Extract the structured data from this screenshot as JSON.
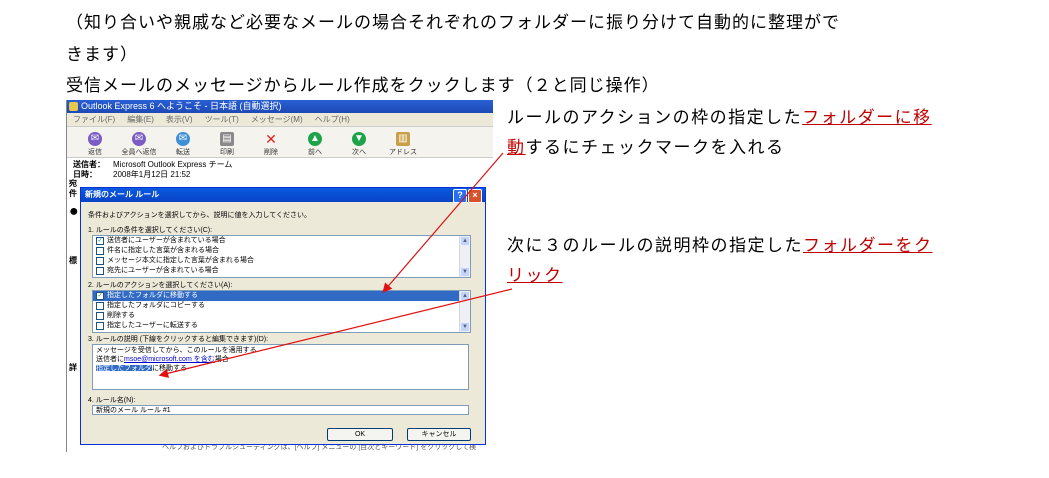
{
  "doc": {
    "line1": "（知り合いや親戚など必要なメールの場合それぞれのフォルダーに振り分けて自動的に整理がで",
    "line2": "きます）",
    "line3": "受信メールのメッセージからルール作成をクックします（２と同じ操作）"
  },
  "note1": {
    "text_a": "ルールのアクションの枠の指定した",
    "link_a": "フォルダーに移",
    "link_b": "動",
    "text_b": "するにチェックマークを入れる"
  },
  "note2": {
    "text_a": "次に３のルールの説明枠の指定した",
    "link_a": "フォルダーをク",
    "link_b": "リック"
  },
  "outlook": {
    "title": "Outlook Express 6 へようこそ - 日本語 (自動選択)",
    "menu": [
      "ファイル(F)",
      "編集(E)",
      "表示(V)",
      "ツール(T)",
      "メッセージ(M)",
      "ヘルプ(H)"
    ],
    "toolbar": [
      "返信",
      "全員へ返信",
      "転送",
      "印刷",
      "削除",
      "前へ",
      "次へ",
      "アドレス"
    ],
    "from_label": "送信者：",
    "from_value": "Microsoft Outlook Express チーム",
    "date_label": "日時：",
    "date_value": "2008年1月12日 21:52",
    "side_a": "宛",
    "side_b": "件",
    "side_c": "標",
    "side_d": "詳",
    "bottom_text": "ヘルプおよびトラブルシューティングは、[ヘルプ] メニューの [目次とキーワード] をクリックして検"
  },
  "dialog": {
    "title": "新規のメール ルール",
    "help_btn": "?",
    "close_btn": "×",
    "intro": "条件およびアクションを選択してから、説明に値を入力してください。",
    "section1": "1. ルールの条件を選択してください(C):",
    "conditions": [
      {
        "label": "送信者にユーザーが含まれている場合",
        "checked": true
      },
      {
        "label": "件名に指定した言葉が含まれる場合",
        "checked": false
      },
      {
        "label": "メッセージ本文に指定した言葉が含まれる場合",
        "checked": false
      },
      {
        "label": "宛先にユーザーが含まれている場合",
        "checked": false
      }
    ],
    "section2": "2. ルールのアクションを選択してください(A):",
    "actions": [
      {
        "label": "指定したフォルダに移動する",
        "checked": true,
        "selected": true
      },
      {
        "label": "指定したフォルダにコピーする",
        "checked": false,
        "selected": false
      },
      {
        "label": "削除する",
        "checked": false,
        "selected": false
      },
      {
        "label": "指定したユーザーに転送する",
        "checked": false,
        "selected": false
      }
    ],
    "section3": "3. ルールの説明 (下線をクリックすると編集できます)(D):",
    "desc_line1": "メッセージを受信してから、このルールを適用する",
    "desc_line2a": "送信者に",
    "desc_line2b": "msoe@microsoft.com を含む",
    "desc_line2c": "場合",
    "desc_line3a": "指定したフォルダ",
    "desc_line3b": "に移動する",
    "section4": "4. ルール名(N):",
    "rule_name": "新規のメール ルール #1",
    "ok": "OK",
    "cancel": "キャンセル"
  }
}
